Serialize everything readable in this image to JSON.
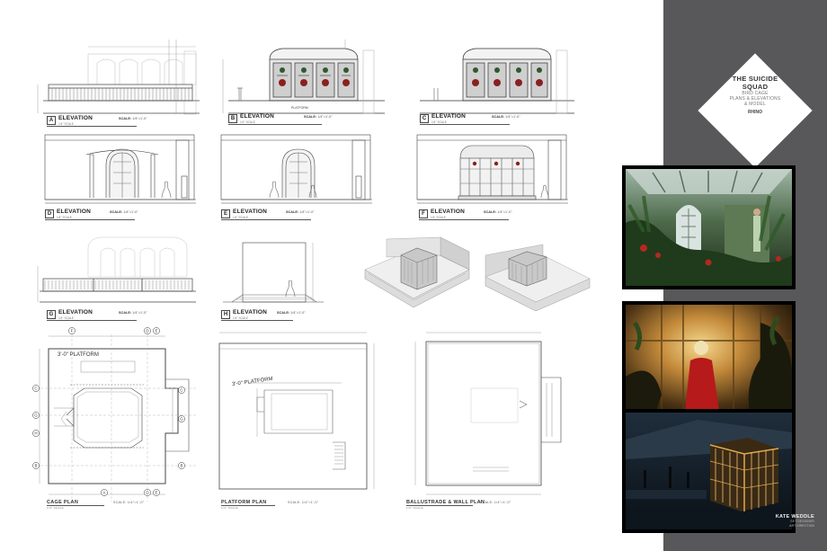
{
  "title": {
    "main_line1": "THE SUICIDE",
    "main_line2": "SQUAD",
    "sub_line1": "BIRD CAGE",
    "sub_line2": "PLANS & ELEVATIONS",
    "sub_line3": "& MODEL",
    "tool": "RHINO"
  },
  "credit": {
    "name": "KATE WEDDLE",
    "line1": "SET DESIGNER",
    "line2": "ART DIRECTION"
  },
  "drawings": {
    "a": {
      "letter": "A",
      "name": "ELEVATION",
      "sub": "1/4\" SCALE",
      "scale_label": "SCALE:",
      "scale_value": "1/4\"=1'-0\""
    },
    "b": {
      "letter": "B",
      "name": "ELEVATION",
      "sub": "1/4\" SCALE",
      "scale_label": "SCALE:",
      "scale_value": "1/4\"=1'-0\""
    },
    "c": {
      "letter": "C",
      "name": "ELEVATION",
      "sub": "1/4\" SCALE",
      "scale_label": "SCALE:",
      "scale_value": "1/4\"=1'-0\""
    },
    "d": {
      "letter": "D",
      "name": "ELEVATION",
      "sub": "1/4\" SCALE",
      "scale_label": "SCALE:",
      "scale_value": "1/4\"=1'-0\""
    },
    "e": {
      "letter": "E",
      "name": "ELEVATION",
      "sub": "1/4\" SCALE",
      "scale_label": "SCALE:",
      "scale_value": "1/4\"=1'-0\""
    },
    "f": {
      "letter": "F",
      "name": "ELEVATION",
      "sub": "1/4\" SCALE",
      "scale_label": "SCALE:",
      "scale_value": "1/4\"=1'-0\""
    },
    "g": {
      "letter": "G",
      "name": "ELEVATION",
      "sub": "1/4\" SCALE",
      "scale_label": "SCALE:",
      "scale_value": "1/4\"=1'-0\""
    },
    "h": {
      "letter": "H",
      "name": "ELEVATION",
      "sub": "1/4\" SCALE",
      "scale_label": "SCALE:",
      "scale_value": "1/4\"=1'-0\""
    }
  },
  "platform_note": "PLATFORM",
  "plans": {
    "cage": {
      "name": "CAGE PLAN",
      "sub": "1/4\" SCALE",
      "scale": "SCALE: 1/4\"=1'-0\"",
      "platform_text": "3'-0\" PLATFORM"
    },
    "platform": {
      "name": "PLATFORM PLAN",
      "sub": "1/4\" SCALE",
      "scale": "SCALE: 1/4\"=1'-0\"",
      "platform_text": "3'-0\" PLATFORM"
    },
    "ballustrade": {
      "name": "BALLUSTRADE & WALL PLAN",
      "sub": "1/4\" SCALE",
      "scale": "SCALE: 1/4\"=1'-0\""
    }
  },
  "grid_markers": {
    "top": [
      "F",
      "D",
      "E"
    ],
    "left": [
      "C",
      "G",
      "H",
      "B"
    ],
    "right": [
      "C",
      "G",
      "B"
    ],
    "bottom": [
      "A",
      "D",
      "E"
    ]
  }
}
